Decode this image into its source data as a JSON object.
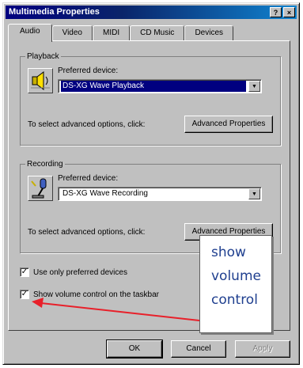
{
  "window": {
    "title": "Multimedia Properties",
    "help_label": "?",
    "close_label": "×"
  },
  "tabs": [
    {
      "label": "Audio",
      "active": true
    },
    {
      "label": "Video"
    },
    {
      "label": "MIDI"
    },
    {
      "label": "CD Music"
    },
    {
      "label": "Devices"
    }
  ],
  "playback": {
    "group_label": "Playback",
    "device_label": "Preferred device:",
    "device_value": "DS-XG Wave Playback",
    "advanced_hint": "To select advanced options, click:",
    "advanced_button": "Advanced Properties",
    "icon": "speaker-icon"
  },
  "recording": {
    "group_label": "Recording",
    "device_label": "Preferred device:",
    "device_value": "DS-XG Wave Recording",
    "advanced_hint": "To select advanced options, click:",
    "advanced_button": "Advanced Properties",
    "icon": "microphone-icon"
  },
  "options": {
    "use_preferred": {
      "label": "Use only preferred devices",
      "checked": true
    },
    "show_volume": {
      "label": "Show volume control on the taskbar",
      "checked": true
    }
  },
  "buttons": {
    "ok": "OK",
    "cancel": "Cancel",
    "apply": "Apply"
  },
  "callout": {
    "line1": "show",
    "line2": "volume",
    "line3": "control",
    "arrow_color": "#e8202a",
    "text_color": "#1f3f8f"
  },
  "colors": {
    "titlebar": "#000080",
    "face": "#c0c0c0",
    "selection": "#000080"
  }
}
